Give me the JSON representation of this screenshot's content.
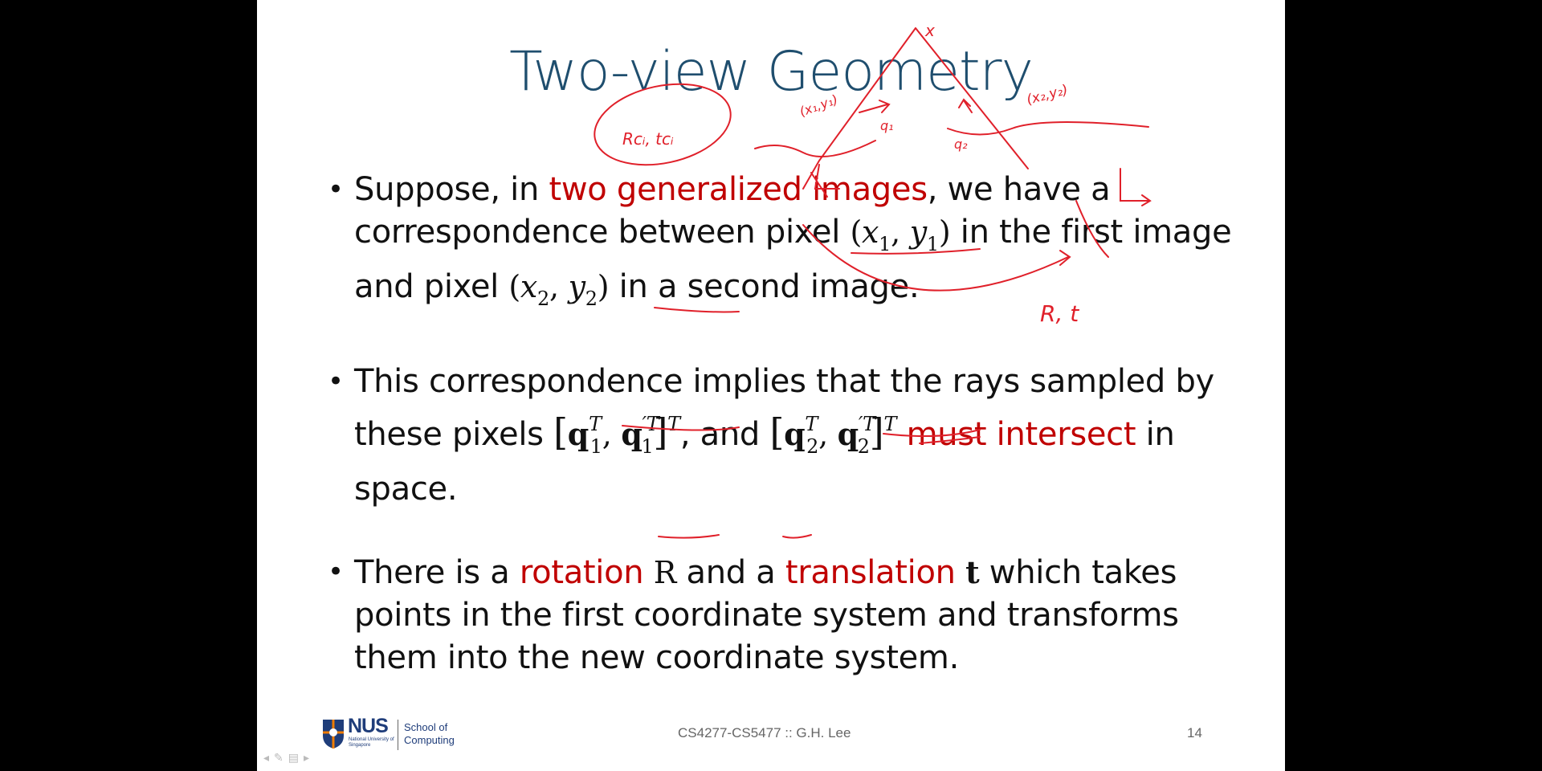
{
  "colors": {
    "title": "#1f4e6e",
    "highlight": "#c00000",
    "ink": "#e0202a",
    "nus_blue": "#1f3d7a",
    "nus_orange": "#ef7c00"
  },
  "slide": {
    "title": "Two-view Geometry",
    "bullet1": {
      "t1": "Suppose, in ",
      "h1": "two generalized images",
      "t2": ", we have a correspondence between pixel ",
      "t3": " in the first image and pixel ",
      "t4": " in a second image."
    },
    "bullet2": {
      "t1": "This correspondence implies that the rays sampled by these pixels ",
      "t2": ", and ",
      "h1": "must intersect",
      "t3": " in space."
    },
    "bullet3": {
      "t1": "There is a ",
      "h1": "rotation",
      "h2": "translation",
      "t2": " and a ",
      "t3": " which takes points in the first coordinate system and transforms them into the new coordinate system."
    },
    "math": {
      "x": "x",
      "y": "y",
      "one": "1",
      "two": "2",
      "q": "q",
      "T": "T",
      "primeT": "′T",
      "R": "R",
      "t": "t",
      "lparen": "(",
      "rparen": ")",
      "comma": ",",
      "lbr": "[",
      "rbr": "]"
    },
    "footer": {
      "course": "CS4277-CS5477 :: G.H. Lee",
      "page": "14",
      "logo_name": "NUS",
      "logo_sub": "National University of Singapore",
      "school": "School of Computing"
    },
    "handwriting": {
      "rc": "Rcᵢ, tcᵢ",
      "x1y1": "(x₁,y₁)",
      "x2y2": "(x₂,y₂)",
      "q1": "q₁",
      "q2": "q₂",
      "x": "x",
      "rt": "R, t"
    }
  }
}
